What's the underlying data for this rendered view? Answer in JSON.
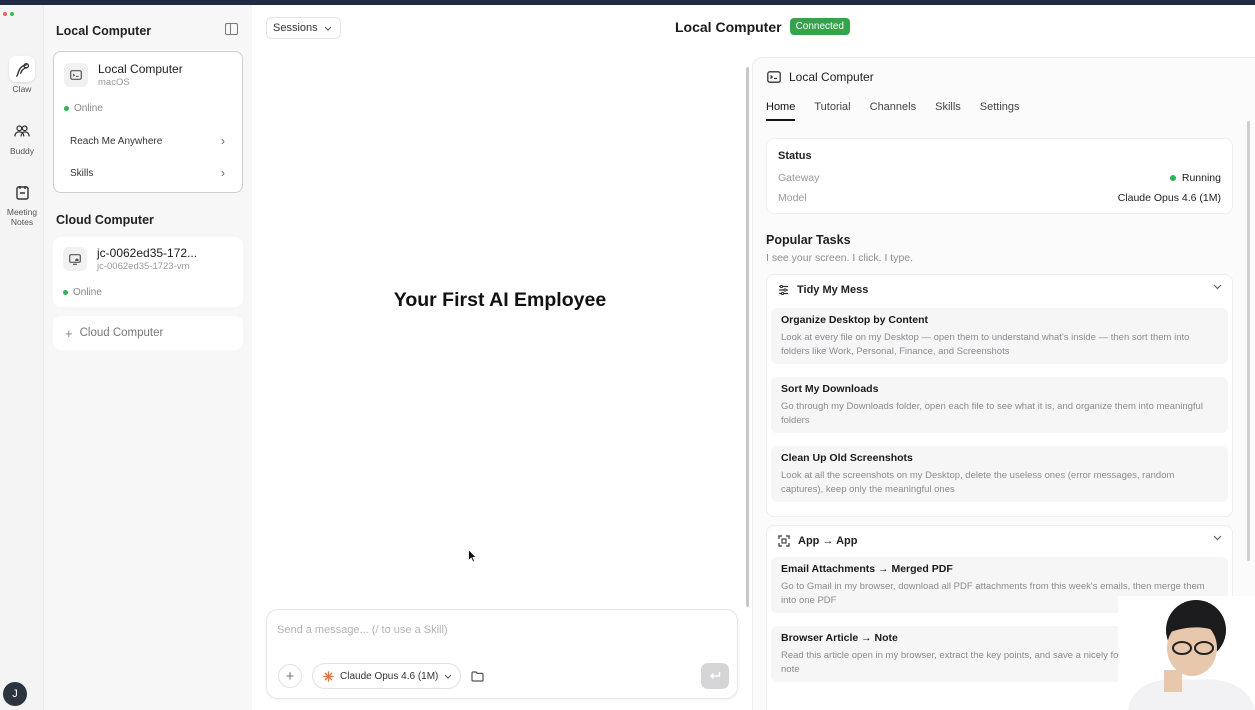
{
  "rail": {
    "items": [
      {
        "label": "Claw",
        "icon": "claw-icon"
      },
      {
        "label": "Buddy",
        "icon": "buddy-icon"
      },
      {
        "label": "Meeting Notes",
        "label_l1": "Meeting",
        "label_l2": "Notes",
        "icon": "notes-icon"
      }
    ],
    "avatar_initial": "J"
  },
  "sidebar": {
    "local_heading": "Local Computer",
    "local_device": {
      "name": "Local Computer",
      "os": "macOS",
      "status": "Online",
      "rows": [
        {
          "label": "Reach Me Anywhere"
        },
        {
          "label": "Skills"
        }
      ]
    },
    "cloud_heading": "Cloud Computer",
    "cloud_device": {
      "name": "jc-0062ed35-172...",
      "id": "jc-0062ed35-1723-vm",
      "status": "Online"
    },
    "add_cloud_label": "Cloud Computer"
  },
  "header": {
    "sessions_label": "Sessions",
    "title": "Local Computer",
    "status_badge": "Connected",
    "badge_color": "#37a24a"
  },
  "main": {
    "hero": "Your First AI Employee",
    "composer": {
      "placeholder": "Send a message... (/ to use a Skill)",
      "model": "Claude Opus 4.6 (1M)"
    }
  },
  "panel": {
    "title": "Local Computer",
    "tabs": [
      "Home",
      "Tutorial",
      "Channels",
      "Skills",
      "Settings"
    ],
    "active_tab": "Home",
    "status": {
      "heading": "Status",
      "gateway_label": "Gateway",
      "gateway_value": "Running",
      "model_label": "Model",
      "model_value": "Claude Opus 4.6 (1M)"
    },
    "popular_title": "Popular Tasks",
    "popular_sub": "I see your screen. I click. I type.",
    "groups": [
      {
        "title": "Tidy My Mess",
        "icon": "list-icon",
        "tasks": [
          {
            "title": "Organize Desktop by Content",
            "desc": "Look at every file on my Desktop — open them to understand what's inside — then sort them into folders like Work, Personal, Finance, and Screenshots"
          },
          {
            "title": "Sort My Downloads",
            "desc": "Go through my Downloads folder, open each file to see what it is, and organize them into meaningful folders"
          },
          {
            "title": "Clean Up Old Screenshots",
            "desc": "Look at all the screenshots on my Desktop, delete the useless ones (error messages, random captures), keep only the meaningful ones"
          }
        ]
      },
      {
        "title": "App → App",
        "icon": "app-transfer-icon",
        "tasks": [
          {
            "title": "Email Attachments → Merged PDF",
            "desc": "Go to Gmail in my browser, download all PDF attachments from this week's emails, then merge them into one PDF"
          },
          {
            "title": "Browser Article → Note",
            "desc": "Read this article open in my browser, extract the key points, and save a nicely formatted version as a note"
          }
        ]
      }
    ]
  }
}
